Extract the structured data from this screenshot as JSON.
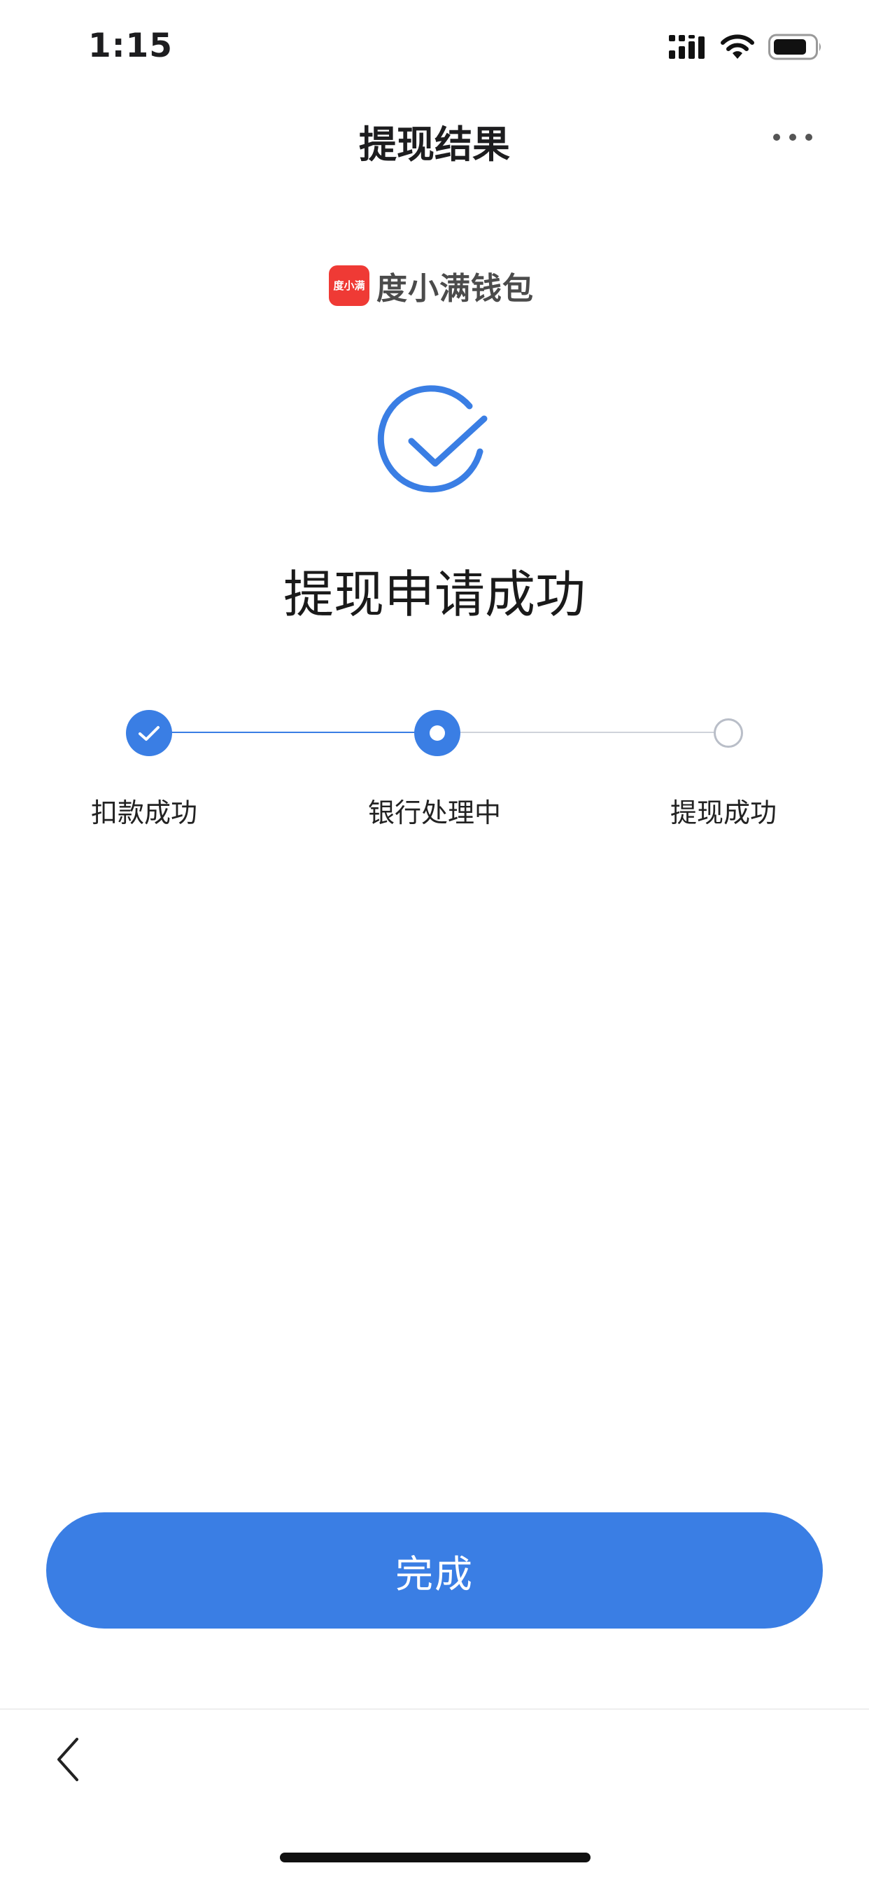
{
  "status_bar": {
    "time": "1:15"
  },
  "header": {
    "title": "提现结果",
    "more_icon": "more-horizontal-icon"
  },
  "brand": {
    "logo_text": "度小满",
    "name": "度小满钱包"
  },
  "result": {
    "icon": "check-circle-icon",
    "title": "提现申请成功"
  },
  "steps": [
    {
      "label": "扣款成功",
      "state": "done"
    },
    {
      "label": "银行处理中",
      "state": "current"
    },
    {
      "label": "提现成功",
      "state": "pending"
    }
  ],
  "actions": {
    "done_label": "完成"
  },
  "colors": {
    "accent": "#3a7ee4",
    "pending": "#b9bec8"
  }
}
